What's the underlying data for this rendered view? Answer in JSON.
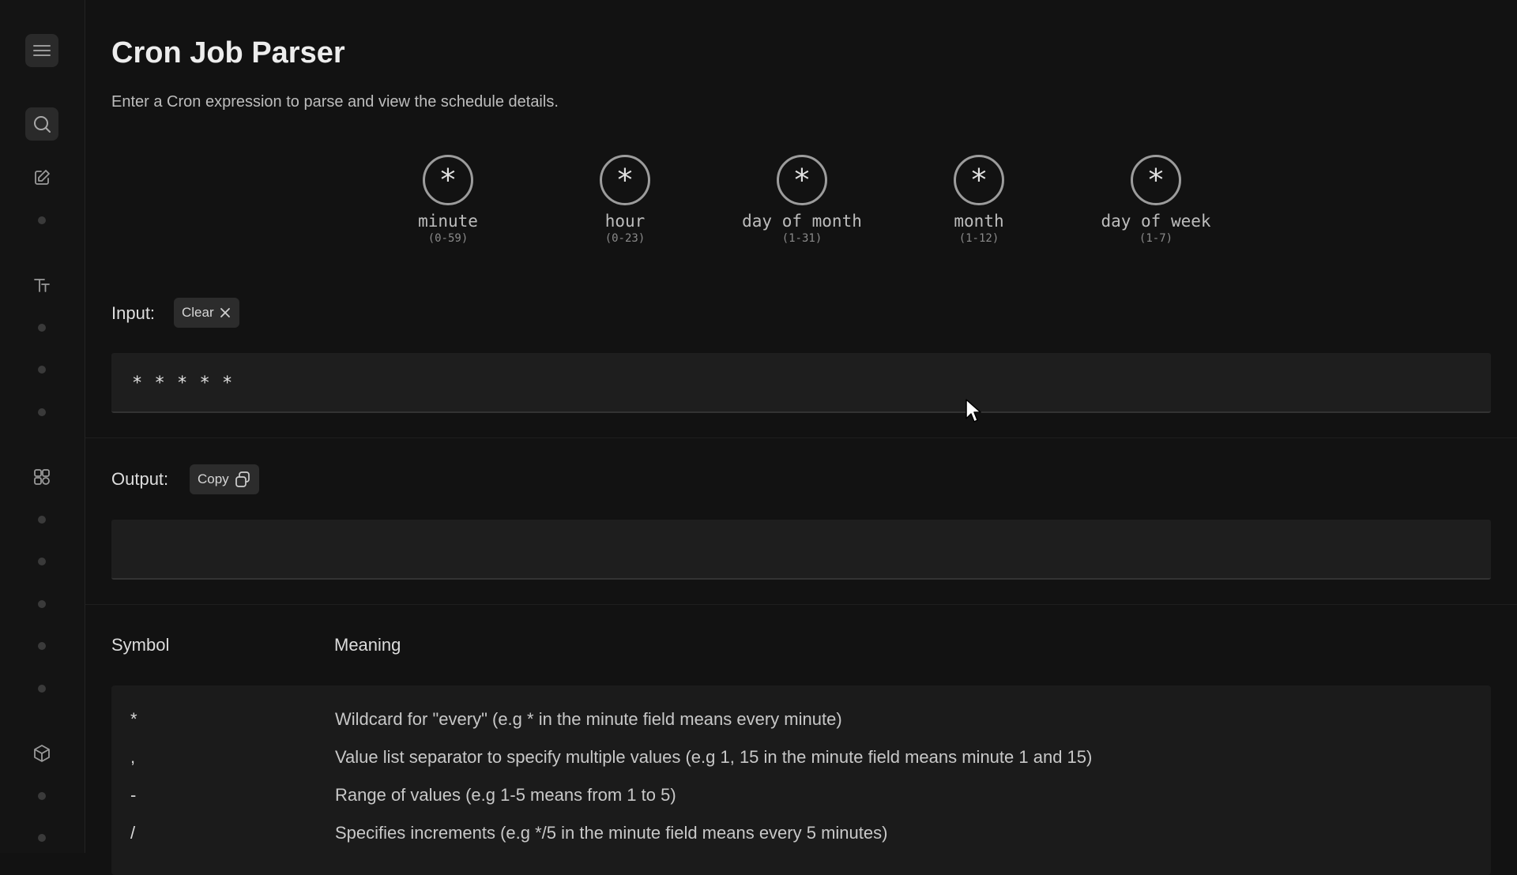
{
  "page": {
    "title": "Cron Job Parser",
    "subtitle": "Enter a Cron expression to parse and view the schedule details."
  },
  "sidebar": {
    "icons": [
      "menu-icon",
      "search-icon",
      "edit-icon",
      "text-icon",
      "shapes-icon",
      "cube-icon"
    ]
  },
  "fields": [
    {
      "symbol": "*",
      "name": "minute",
      "range": "(0-59)"
    },
    {
      "symbol": "*",
      "name": "hour",
      "range": "(0-23)"
    },
    {
      "symbol": "*",
      "name": "day of month",
      "range": "(1-31)"
    },
    {
      "symbol": "*",
      "name": "month",
      "range": "(1-12)"
    },
    {
      "symbol": "*",
      "name": "day of week",
      "range": "(1-7)"
    }
  ],
  "input": {
    "label": "Input:",
    "clear_label": "Clear",
    "value": "* * * * *"
  },
  "output": {
    "label": "Output:",
    "copy_label": "Copy",
    "value": ""
  },
  "table": {
    "headers": [
      "Symbol",
      "Meaning"
    ],
    "rows": [
      {
        "symbol": "*",
        "meaning": "Wildcard for \"every\" (e.g * in the minute field means every minute)"
      },
      {
        "symbol": ",",
        "meaning": "Value list separator to specify multiple values (e.g 1, 15 in the minute field means minute 1 and 15)"
      },
      {
        "symbol": "-",
        "meaning": "Range of values (e.g 1-5 means from 1 to 5)"
      },
      {
        "symbol": "/",
        "meaning": "Specifies increments (e.g */5 in the minute field means every 5 minutes)"
      }
    ]
  },
  "colors": {
    "background": "#121212",
    "sidebar": "#141414",
    "panel": "#1e1e1e",
    "text": "#e6e6e6"
  }
}
